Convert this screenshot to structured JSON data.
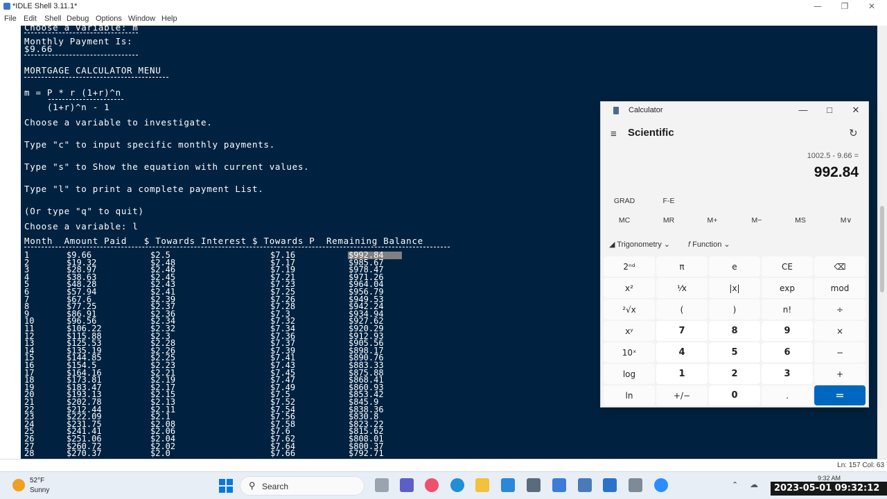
{
  "idle": {
    "title": "*IDLE Shell 3.11.1*",
    "menu": [
      "File",
      "Edit",
      "Shell",
      "Debug",
      "Options",
      "Window",
      "Help"
    ],
    "lines": [
      "Choose a variable: m",
      "Monthly Payment Is:",
      "$9.66",
      "MORTGAGE CALCULATOR MENU",
      "m = P * r (1+r)^n",
      "    (1+r)^n - 1",
      "Choose a variable to investigate.",
      "Type \"c\" to input specific monthly payments.",
      "Type \"s\" to Show the equation with current values.",
      "Type \"l\" to print a complete payment List.",
      "(Or type \"q\" to quit)",
      "Choose a variable: l",
      "Month  Amount Paid   $ Towards Interest $ Towards P  Remaining Balance"
    ],
    "table": [
      [
        "1",
        "$9.66",
        "$2.5",
        "$7.16",
        "$992.84"
      ],
      [
        "2",
        "$19.32",
        "$2.48",
        "$7.17",
        "$985.67"
      ],
      [
        "3",
        "$28.97",
        "$2.46",
        "$7.19",
        "$978.47"
      ],
      [
        "4",
        "$38.63",
        "$2.45",
        "$7.21",
        "$971.26"
      ],
      [
        "5",
        "$48.28",
        "$2.43",
        "$7.23",
        "$964.04"
      ],
      [
        "6",
        "$57.94",
        "$2.41",
        "$7.25",
        "$956.79"
      ],
      [
        "7",
        "$67.6",
        "$2.39",
        "$7.26",
        "$949.53"
      ],
      [
        "8",
        "$77.25",
        "$2.37",
        "$7.28",
        "$942.24"
      ],
      [
        "9",
        "$86.91",
        "$2.36",
        "$7.3",
        "$934.94"
      ],
      [
        "10",
        "$96.56",
        "$2.34",
        "$7.32",
        "$927.62"
      ],
      [
        "11",
        "$106.22",
        "$2.32",
        "$7.34",
        "$920.29"
      ],
      [
        "12",
        "$115.88",
        "$2.3",
        "$7.36",
        "$912.93"
      ],
      [
        "13",
        "$125.53",
        "$2.28",
        "$7.37",
        "$905.56"
      ],
      [
        "14",
        "$135.19",
        "$2.26",
        "$7.39",
        "$898.17"
      ],
      [
        "15",
        "$144.85",
        "$2.25",
        "$7.41",
        "$890.76"
      ],
      [
        "16",
        "$154.5",
        "$2.23",
        "$7.43",
        "$883.33"
      ],
      [
        "17",
        "$164.16",
        "$2.21",
        "$7.45",
        "$875.88"
      ],
      [
        "18",
        "$173.81",
        "$2.19",
        "$7.47",
        "$868.41"
      ],
      [
        "19",
        "$183.47",
        "$2.17",
        "$7.49",
        "$860.93"
      ],
      [
        "20",
        "$193.13",
        "$2.15",
        "$7.5",
        "$853.42"
      ],
      [
        "21",
        "$202.78",
        "$2.13",
        "$7.52",
        "$845.9"
      ],
      [
        "22",
        "$212.44",
        "$2.11",
        "$7.54",
        "$838.36"
      ],
      [
        "23",
        "$222.09",
        "$2.1",
        "$7.56",
        "$830.8"
      ],
      [
        "24",
        "$231.75",
        "$2.08",
        "$7.58",
        "$823.22"
      ],
      [
        "25",
        "$241.41",
        "$2.06",
        "$7.6",
        "$815.62"
      ],
      [
        "26",
        "$251.06",
        "$2.04",
        "$7.62",
        "$808.01"
      ],
      [
        "27",
        "$260.72",
        "$2.02",
        "$7.64",
        "$800.37"
      ],
      [
        "28",
        "$270.37",
        "$2.0",
        "$7.66",
        "$792.71"
      ]
    ],
    "status": "Ln: 157   Col: 63",
    "colors": {
      "shell_bg": "#002240",
      "text": "#ffffff",
      "highlight": "#808080"
    }
  },
  "calculator": {
    "title": "Calculator",
    "mode": "Scientific",
    "expression": "1002.5 - 9.66 =",
    "result": "992.84",
    "angle": "GRAD",
    "fe": "F-E",
    "memory": [
      "MC",
      "MR",
      "M+",
      "M−",
      "MS",
      "M∨"
    ],
    "trig_label": "Trigonometry",
    "func_label": "Function",
    "keys": [
      [
        "2ⁿᵈ",
        "π",
        "e",
        "CE",
        "⌫"
      ],
      [
        "x²",
        "¹⁄x",
        "|x|",
        "exp",
        "mod"
      ],
      [
        "²√x",
        "(",
        ")",
        "n!",
        "÷"
      ],
      [
        "xʸ",
        "7",
        "8",
        "9",
        "×"
      ],
      [
        "10ˣ",
        "4",
        "5",
        "6",
        "−"
      ],
      [
        "log",
        "1",
        "2",
        "3",
        "+"
      ],
      [
        "ln",
        "+/−",
        "0",
        ".",
        "="
      ]
    ],
    "accent": "#0067c0"
  },
  "taskbar": {
    "weather_temp": "52°F",
    "weather_desc": "Sunny",
    "search_label": "Search",
    "tray_time": "9:32 AM",
    "datestamp": "2023-05-01  09:32:12"
  }
}
